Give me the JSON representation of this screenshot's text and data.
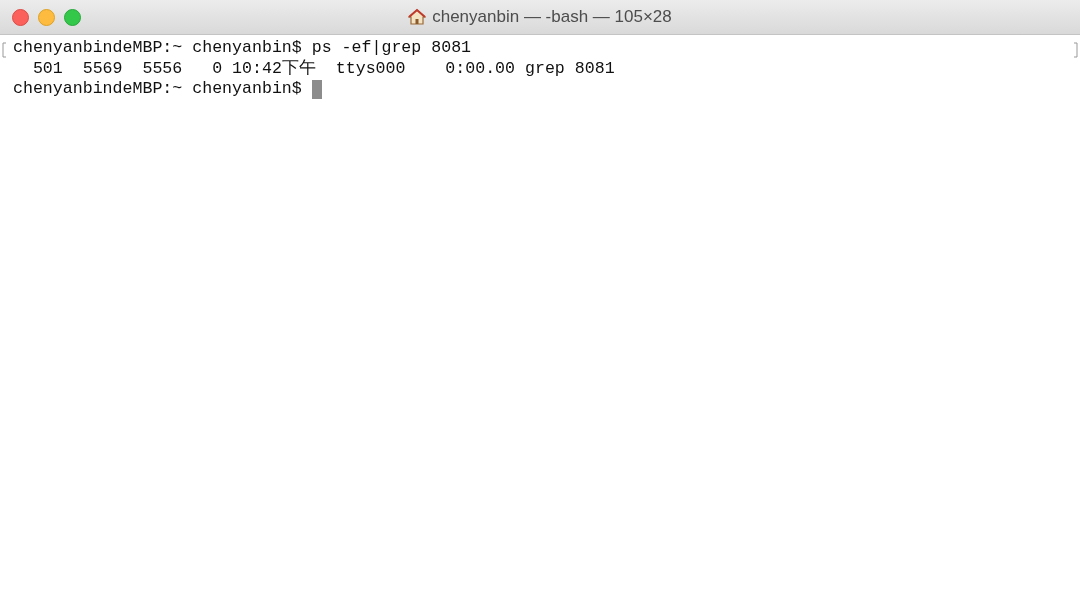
{
  "window": {
    "title": "chenyanbin — -bash — 105×28"
  },
  "terminal": {
    "lines": [
      {
        "text": "chenyanbindeMBP:~ chenyanbin$ ps -ef|grep 8081",
        "cursor": false
      },
      {
        "text": "  501  5569  5556   0 10:42下午  ttys000    0:00.00 grep 8081",
        "cursor": false
      },
      {
        "text": "chenyanbindeMBP:~ chenyanbin$ ",
        "cursor": true
      }
    ]
  }
}
